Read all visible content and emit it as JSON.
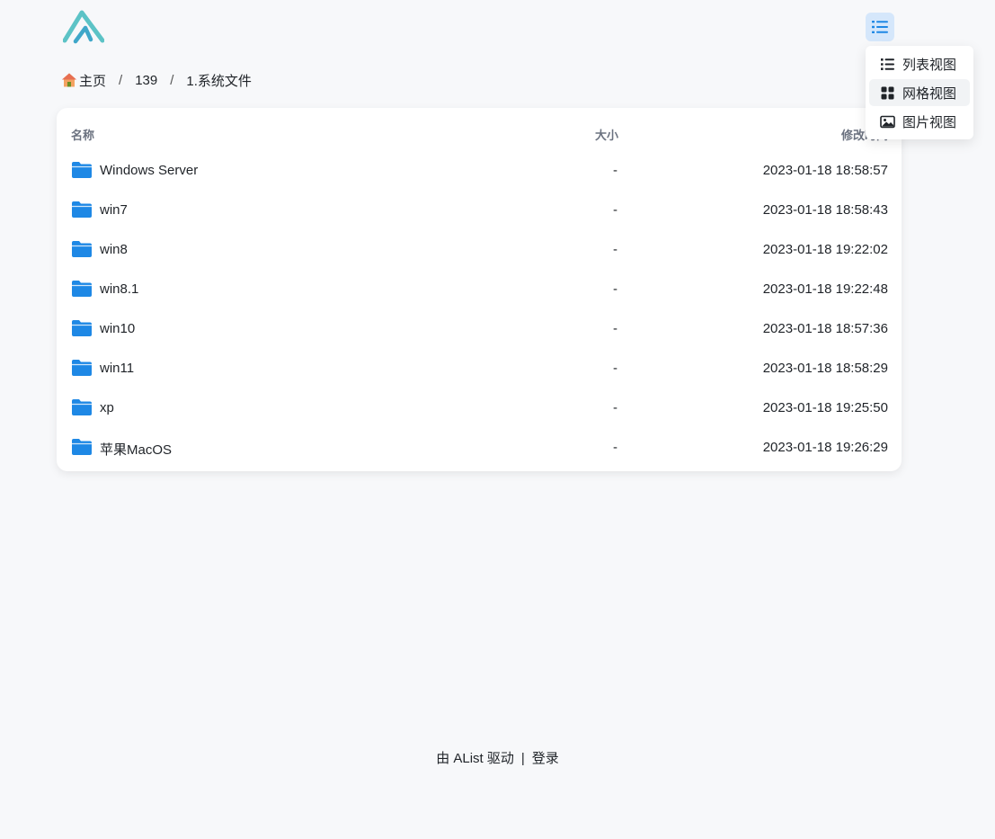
{
  "header": {
    "logo_icon": "alist-logo-icon",
    "view_toggle_icon": "list-icon",
    "accent": "#1e88e5"
  },
  "breadcrumb": {
    "home_icon": "house-icon",
    "items": [
      "主页",
      "139",
      "1.系统文件"
    ]
  },
  "table": {
    "columns": {
      "name": "名称",
      "size": "大小",
      "modified": "修改时间"
    },
    "folder_icon": "folder-icon",
    "rows": [
      {
        "name": "Windows Server",
        "size": "-",
        "modified": "2023-01-18 18:58:57"
      },
      {
        "name": "win7",
        "size": "-",
        "modified": "2023-01-18 18:58:43"
      },
      {
        "name": "win8",
        "size": "-",
        "modified": "2023-01-18 19:22:02"
      },
      {
        "name": "win8.1",
        "size": "-",
        "modified": "2023-01-18 19:22:48"
      },
      {
        "name": "win10",
        "size": "-",
        "modified": "2023-01-18 18:57:36"
      },
      {
        "name": "win11",
        "size": "-",
        "modified": "2023-01-18 18:58:29"
      },
      {
        "name": "xp",
        "size": "-",
        "modified": "2023-01-18 19:25:50"
      },
      {
        "name": "苹果MacOS",
        "size": "-",
        "modified": "2023-01-18 19:26:29"
      }
    ]
  },
  "view_menu": {
    "items": [
      {
        "label": "列表视图",
        "icon": "list-icon"
      },
      {
        "label": "网格视图",
        "icon": "grid-icon"
      },
      {
        "label": "图片视图",
        "icon": "image-icon"
      }
    ]
  },
  "footer": {
    "powered_by": "由 AList 驱动",
    "separator": "|",
    "login": "登录"
  }
}
